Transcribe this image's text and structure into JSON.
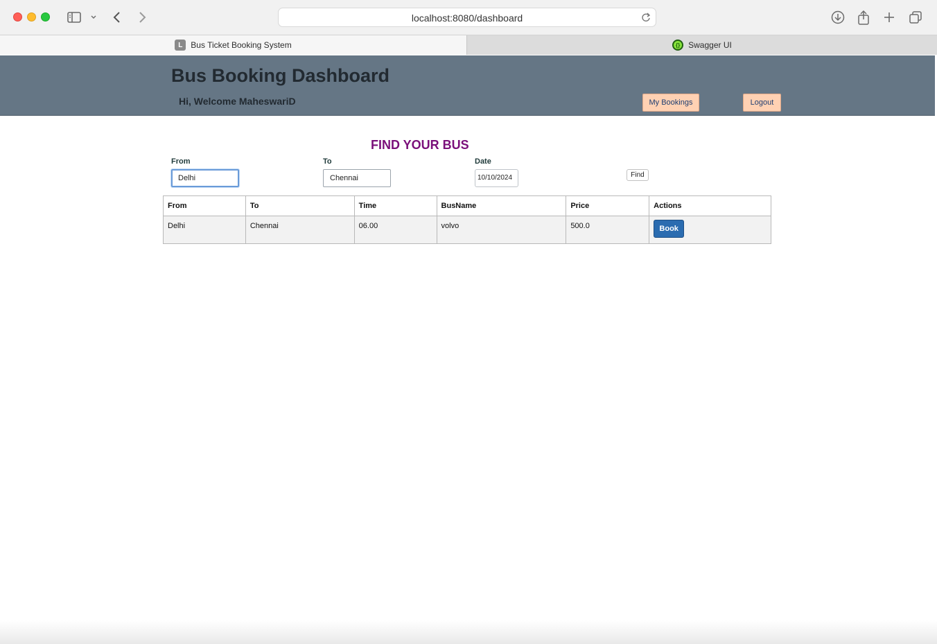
{
  "browser": {
    "url": "localhost:8080/dashboard",
    "tabs": [
      {
        "label": "Bus Ticket Booking System",
        "favicon": "L",
        "active": true
      },
      {
        "label": "Swagger UI",
        "favicon": "swagger-icon",
        "active": false
      }
    ]
  },
  "header": {
    "title": "Bus Booking Dashboard",
    "welcome": "Hi, Welcome MaheswariD",
    "my_bookings_label": "My Bookings",
    "logout_label": "Logout",
    "background_color": "#657685",
    "button_color": "#ffd1b3"
  },
  "search": {
    "title": "FIND YOUR BUS",
    "title_color": "#7a0f7a",
    "from_label": "From",
    "from_value": "Delhi",
    "to_label": "To",
    "to_value": "Chennai",
    "date_label": "Date",
    "date_value": "10/10/2024",
    "find_label": "Find"
  },
  "results": {
    "columns": [
      "From",
      "To",
      "Time",
      "BusName",
      "Price",
      "Actions"
    ],
    "rows": [
      {
        "from": "Delhi",
        "to": "Chennai",
        "time": "06.00",
        "bus_name": "volvo",
        "price": "500.0",
        "action_label": "Book"
      }
    ],
    "action_color": "#2b6cb0"
  }
}
